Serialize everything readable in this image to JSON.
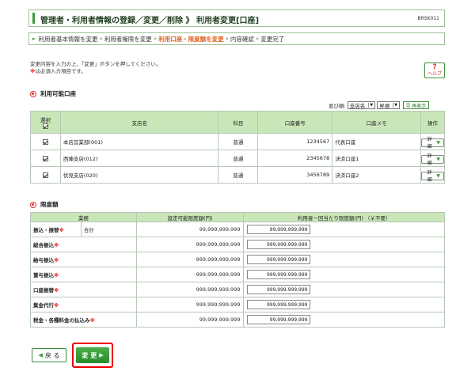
{
  "header": {
    "title": "管理者・利用者情報の登録／変更／削除 》 利用者変更[口座]",
    "screen_id": "BRSK011"
  },
  "steps": [
    {
      "label": "利用者基本情報を変更",
      "current": false
    },
    {
      "label": "利用者権限を変更",
      "current": false
    },
    {
      "label": "利用口座・限度額を変更",
      "current": true
    },
    {
      "label": "内容確認",
      "current": false
    },
    {
      "label": "変更完了",
      "current": false
    }
  ],
  "instructions": {
    "line1": "変更内容を入力の上、「変更」ボタンを押してください。",
    "req_mark": "※",
    "line2": "は必須入力項目です。"
  },
  "help": {
    "symbol": "?",
    "label": "ヘルプ"
  },
  "accounts": {
    "section_title": "利用可能口座",
    "sort": {
      "label": "並び順:",
      "field": "支店名",
      "order": "昇順",
      "show_button": "再表示"
    },
    "columns": {
      "select": "選択",
      "branch": "支店名",
      "type": "科目",
      "number": "口座番号",
      "memo": "口座メモ",
      "action": "操作"
    },
    "rows": [
      {
        "branch": "本店営業部(001)",
        "type": "普通",
        "number": "1234567",
        "memo": "代表口座",
        "checked": true,
        "action": "詳 細"
      },
      {
        "branch": "西陣支店(012)",
        "type": "普通",
        "number": "2345678",
        "memo": "決済口座1",
        "checked": true,
        "action": "詳 細"
      },
      {
        "branch": "伏見支店(020)",
        "type": "普通",
        "number": "3456789",
        "memo": "決済口座2",
        "checked": true,
        "action": "詳 細"
      }
    ]
  },
  "limits": {
    "section_title": "限度額",
    "columns": {
      "business": "業務",
      "settable": "設定可能限度額(円)",
      "per_user": "利用者一回当たり限度額(円) （￥不要）"
    },
    "rows": [
      {
        "label": "振込・振替",
        "sub": "合計",
        "settable": "99,999,999,999",
        "value": "99,999,999,999"
      },
      {
        "label": "総合振込",
        "sub": "",
        "settable": "999,999,999,999",
        "value": "999,999,999,999"
      },
      {
        "label": "給与振込",
        "sub": "",
        "settable": "999,999,999,999",
        "value": "999,999,999,999"
      },
      {
        "label": "賞与振込",
        "sub": "",
        "settable": "999,999,999,999",
        "value": "999,999,999,999"
      },
      {
        "label": "口座振替",
        "sub": "",
        "settable": "999,999,999,999",
        "value": "999,999,999,999"
      },
      {
        "label": "集金代行",
        "sub": "",
        "settable": "999,999,999,999",
        "value": "999,999,999,999"
      },
      {
        "label": "税金・各種料金の払込み",
        "sub": "",
        "settable": "99,999,999,999",
        "value": "99,999,999,999"
      }
    ]
  },
  "footer": {
    "back_label": "戻 る",
    "change_label": "変 更"
  },
  "colors": {
    "accent": "#3b9b3b",
    "header_bg": "#c9e6b8",
    "required": "#e00000",
    "current_step": "#e06020"
  }
}
